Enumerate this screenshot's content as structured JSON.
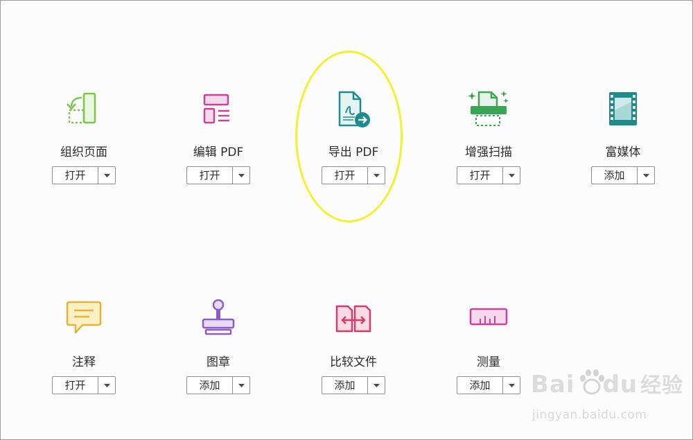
{
  "tools": [
    {
      "id": "organize-pages",
      "name": "组织页面",
      "action": "打开",
      "icon": "organize-pages-icon",
      "color": "#7dc44a"
    },
    {
      "id": "edit-pdf",
      "name": "编辑 PDF",
      "action": "打开",
      "icon": "edit-pdf-icon",
      "color": "#c9419a"
    },
    {
      "id": "export-pdf",
      "name": "导出 PDF",
      "action": "打开",
      "icon": "export-pdf-icon",
      "color": "#1e8c8c"
    },
    {
      "id": "enhance-scans",
      "name": "增强扫描",
      "action": "打开",
      "icon": "enhance-scans-icon",
      "color": "#3aa655"
    },
    {
      "id": "rich-media",
      "name": "富媒体",
      "action": "添加",
      "icon": "rich-media-icon",
      "color": "#1e8c8c"
    },
    {
      "id": "comment",
      "name": "注释",
      "action": "打开",
      "icon": "comment-icon",
      "color": "#e2b536"
    },
    {
      "id": "stamp",
      "name": "图章",
      "action": "添加",
      "icon": "stamp-icon",
      "color": "#8e5cc4"
    },
    {
      "id": "compare-files",
      "name": "比较文件",
      "action": "添加",
      "icon": "compare-files-icon",
      "color": "#d63a6a"
    },
    {
      "id": "measure",
      "name": "测量",
      "action": "添加",
      "icon": "measure-icon",
      "color": "#c9419a"
    }
  ],
  "watermark": {
    "logo_left": "Bai",
    "logo_right": "du",
    "logo_cn": "经验",
    "url": "jingyan.baidu.com"
  }
}
